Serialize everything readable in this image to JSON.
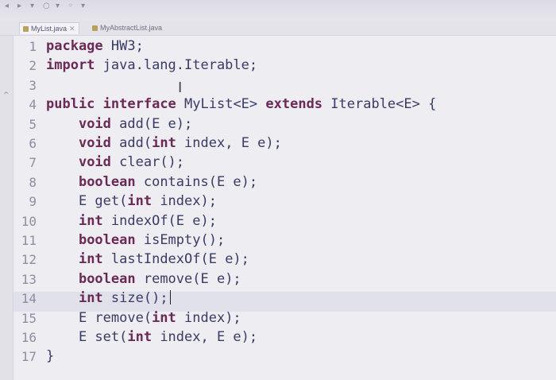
{
  "toolbar": {
    "icons": [
      "back-icon",
      "run-icon",
      "debug-icon",
      "search-icon",
      "coverage-icon",
      "external-tools-icon",
      "refresh-icon"
    ]
  },
  "tabs": [
    {
      "label": "MyList.java",
      "close": "✕",
      "active": true
    },
    {
      "label": "MyAbstractList.java",
      "close": "",
      "active": false
    }
  ],
  "editor": {
    "active_line": 14,
    "lines": [
      {
        "num": "1",
        "tokens": [
          {
            "t": "package",
            "kw": true
          },
          {
            "t": " HW3;",
            "kw": false
          }
        ]
      },
      {
        "num": "2",
        "tokens": [
          {
            "t": "import",
            "kw": true
          },
          {
            "t": " java.lang.Iterable;",
            "kw": false
          }
        ]
      },
      {
        "num": "3",
        "tokens": []
      },
      {
        "num": "4",
        "tokens": [
          {
            "t": "public",
            "kw": true
          },
          {
            "t": " ",
            "kw": false
          },
          {
            "t": "interface",
            "kw": true
          },
          {
            "t": " MyList<E> ",
            "kw": false
          },
          {
            "t": "extends",
            "kw": true
          },
          {
            "t": " Iterable<E> {",
            "kw": false
          }
        ]
      },
      {
        "num": "5",
        "tokens": [
          {
            "t": "    ",
            "kw": false
          },
          {
            "t": "void",
            "kw": true
          },
          {
            "t": " add(E e);",
            "kw": false
          }
        ]
      },
      {
        "num": "6",
        "tokens": [
          {
            "t": "    ",
            "kw": false
          },
          {
            "t": "void",
            "kw": true
          },
          {
            "t": " add(",
            "kw": false
          },
          {
            "t": "int",
            "kw": true
          },
          {
            "t": " index, E e);",
            "kw": false
          }
        ]
      },
      {
        "num": "7",
        "tokens": [
          {
            "t": "    ",
            "kw": false
          },
          {
            "t": "void",
            "kw": true
          },
          {
            "t": " clear();",
            "kw": false
          }
        ]
      },
      {
        "num": "8",
        "tokens": [
          {
            "t": "    ",
            "kw": false
          },
          {
            "t": "boolean",
            "kw": true
          },
          {
            "t": " contains(E e);",
            "kw": false
          }
        ]
      },
      {
        "num": "9",
        "tokens": [
          {
            "t": "    E get(",
            "kw": false
          },
          {
            "t": "int",
            "kw": true
          },
          {
            "t": " index);",
            "kw": false
          }
        ]
      },
      {
        "num": "10",
        "tokens": [
          {
            "t": "    ",
            "kw": false
          },
          {
            "t": "int",
            "kw": true
          },
          {
            "t": " indexOf(E e);",
            "kw": false
          }
        ]
      },
      {
        "num": "11",
        "tokens": [
          {
            "t": "    ",
            "kw": false
          },
          {
            "t": "boolean",
            "kw": true
          },
          {
            "t": " isEmpty();",
            "kw": false
          }
        ]
      },
      {
        "num": "12",
        "tokens": [
          {
            "t": "    ",
            "kw": false
          },
          {
            "t": "int",
            "kw": true
          },
          {
            "t": " lastIndexOf(E e);",
            "kw": false
          }
        ]
      },
      {
        "num": "13",
        "tokens": [
          {
            "t": "    ",
            "kw": false
          },
          {
            "t": "boolean",
            "kw": true
          },
          {
            "t": " remove(E e);",
            "kw": false
          }
        ]
      },
      {
        "num": "14",
        "tokens": [
          {
            "t": "    ",
            "kw": false
          },
          {
            "t": "int",
            "kw": true
          },
          {
            "t": " size();",
            "kw": false
          }
        ]
      },
      {
        "num": "15",
        "tokens": [
          {
            "t": "    E remove(",
            "kw": false
          },
          {
            "t": "int",
            "kw": true
          },
          {
            "t": " index);",
            "kw": false
          }
        ]
      },
      {
        "num": "16",
        "tokens": [
          {
            "t": "    E set(",
            "kw": false
          },
          {
            "t": "int",
            "kw": true
          },
          {
            "t": " index, E e);",
            "kw": false
          }
        ]
      },
      {
        "num": "17",
        "tokens": [
          {
            "t": "}",
            "kw": false
          }
        ]
      }
    ]
  }
}
